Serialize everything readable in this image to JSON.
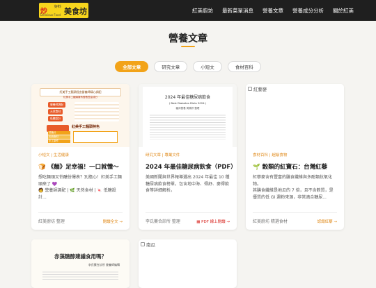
{
  "nav": {
    "logo": {
      "red": "炒",
      "small_top": "好料",
      "big": "美食坊",
      "sub": "Delicious Food"
    },
    "links": [
      "紅美廚坊",
      "最新菜單消息",
      "營養文章",
      "營養成分分析",
      "關於紅美"
    ]
  },
  "page": {
    "title": "營養文章"
  },
  "filters": [
    "全部文章",
    "研究文章",
    "小短文",
    "食材百科"
  ],
  "cards": [
    {
      "category": "小短文 | 生活健康",
      "icon": "🍞",
      "title": "《麵》足幸福！一口就懂～",
      "desc": "想吃麵頭又怕醣份爆表？別擔心！紅美手工麵頭來了 💜",
      "desc2": "🧑 營養師調配 | 🌿 天然食材 | 🍬 低糖設計...",
      "author": "紅美廚坊 整理",
      "more": "閱讀全文 →",
      "img": {
        "head": "紅美手工麵頭經由營養師精心調配",
        "line2": "紅美手工麵頭擁有營養豐富成分",
        "badge1": "營養師調配",
        "badge2": "天然食材",
        "badge3": "低糖設計",
        "list_title": "紅美手工麵頭特色",
        "rows": [
          "低糖分",
          "天然食材",
          "手工製作"
        ]
      }
    },
    {
      "category": "研究文章 | 專業文件",
      "title": "2024 年最佳糖尿病飲食（PDF）",
      "desc": "美國新聞與世界報導選出 2024 年最佳 10 種糖尿病飲食榜單，包含地中海、得舒、麥得飲食等詳細解析。",
      "author": "李氏藥合診所 整理",
      "more": "PDF 線上閱讀 →",
      "img": {
        "title": "2024 年最佳糖尿病飲食",
        "subtitle": "( Best Diabetes Diets 2024 )",
        "byline": "臨床營養 黃美婷 整理"
      }
    },
    {
      "category": "食材百科 | 超級食物",
      "icon": "🌱",
      "title": "穀類的紅寶石：台灣紅藜",
      "desc": "紅藜麥含有豐富的膳食纖維與多酚類抗氧化物。",
      "desc2": "其膳食纖維是地瓜的 7 倍，且不含麩質，是優質的低 GI 澱粉來源，非常適合糖尿...",
      "author": "紅美廚坊 精選食材",
      "more": "認識紅藜 →",
      "alt": "紅藜麥"
    },
    {
      "img": {
        "title": "赤藻糖醇建議食用嗎？",
        "byline": "李氏藥合診所 營養師編輯"
      }
    },
    {
      "alt": "南瓜"
    }
  ],
  "colors": {
    "accent": "#f2a319",
    "nav_bg": "#1f1f1f",
    "page_bg": "#f5f4f1",
    "link": "#e08a1a"
  }
}
